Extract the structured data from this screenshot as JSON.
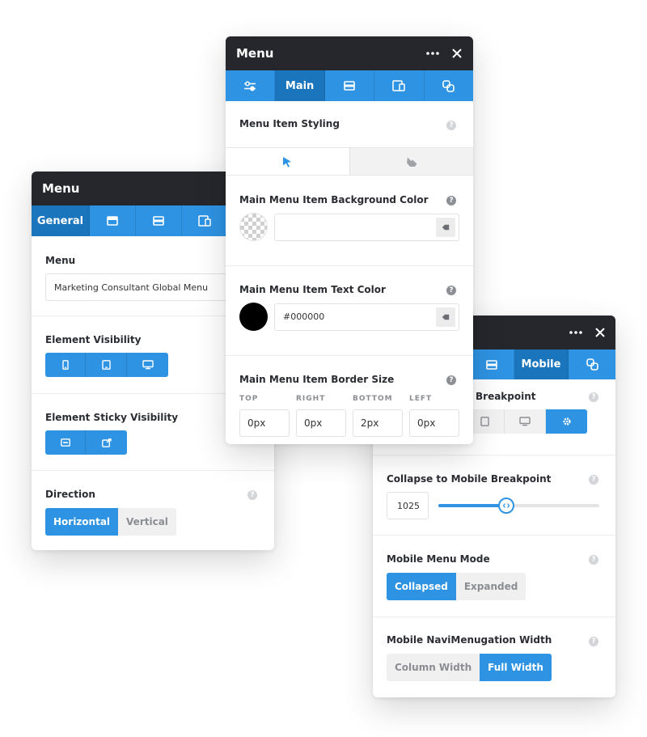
{
  "left_panel": {
    "title": "Menu",
    "tabs": [
      {
        "label": "General",
        "icon": "general-tab"
      },
      {
        "label": "",
        "icon": "layout-icon"
      },
      {
        "label": "",
        "icon": "layout-icon"
      },
      {
        "label": "",
        "icon": "devices-icon"
      }
    ],
    "menu_label": "Menu",
    "menu_value": "Marketing Consultant Global Menu",
    "visibility_label": "Element Visibility",
    "sticky_label": "Element Sticky Visibility",
    "direction_label": "Direction",
    "direction_options": [
      "Horizontal",
      "Vertical"
    ],
    "direction_selected": "Horizontal"
  },
  "center_panel": {
    "title": "Menu",
    "tabs": [
      {
        "label": "",
        "icon": "sliders-icon"
      },
      {
        "label": "Main",
        "icon": ""
      },
      {
        "label": "",
        "icon": "layout-icon"
      },
      {
        "label": "",
        "icon": "devices-icon"
      },
      {
        "label": "",
        "icon": "link-icon"
      }
    ],
    "styling_label": "Menu Item Styling",
    "bg_color_label": "Main Menu Item Background Color",
    "bg_color_value": "",
    "text_color_label": "Main Menu Item Text Color",
    "text_color_value": "#000000",
    "border_label": "Main Menu Item Border Size",
    "border_sides": [
      {
        "label": "TOP",
        "value": "0px"
      },
      {
        "label": "RIGHT",
        "value": "0px"
      },
      {
        "label": "BOTTOM",
        "value": "2px"
      },
      {
        "label": "LEFT",
        "value": "0px"
      }
    ]
  },
  "right_panel": {
    "tabs": [
      {
        "label": "",
        "icon": "layout-icon"
      },
      {
        "label": "Mobile",
        "icon": ""
      },
      {
        "label": "",
        "icon": "link-icon"
      }
    ],
    "breakpoint_label": "Breakpoint",
    "collapse_label": "Collapse to Mobile Breakpoint",
    "collapse_value": "1025",
    "collapse_fraction": 0.42,
    "mode_label": "Mobile Menu Mode",
    "mode_options": [
      "Collapsed",
      "Expanded"
    ],
    "mode_selected": "Collapsed",
    "width_label": "Mobile NaviMenugation Width",
    "width_options": [
      "Column Width",
      "Full Width"
    ],
    "width_selected": "Full Width"
  },
  "colors": {
    "accent": "#2e93e3",
    "accent_active": "#1b75bd",
    "titlebar": "#25272c"
  }
}
